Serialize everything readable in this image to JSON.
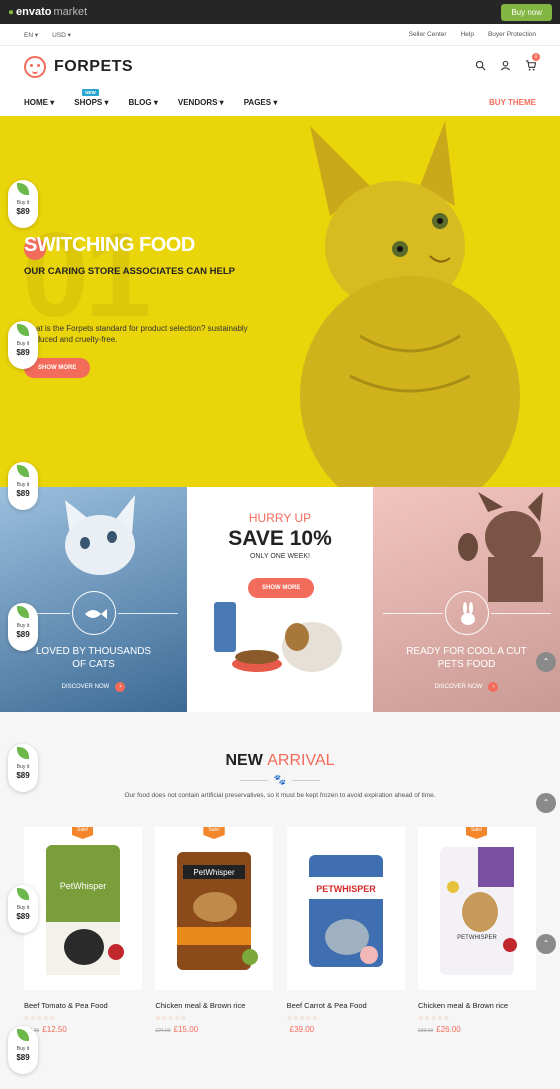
{
  "envato": {
    "logo": "envato",
    "logo_suffix": "market",
    "buy_now": "Buy now"
  },
  "topbar": {
    "lang": "EN",
    "currency": "USD",
    "links": [
      "Seller Center",
      "Help",
      "Buyer Protection"
    ]
  },
  "header": {
    "brand": "FORPETS",
    "cart_count": "0"
  },
  "nav": {
    "items": [
      {
        "label": "HOME",
        "badge": ""
      },
      {
        "label": "SHOPS",
        "badge": "NEW"
      },
      {
        "label": "BLOG",
        "badge": ""
      },
      {
        "label": "VENDORS",
        "badge": ""
      },
      {
        "label": "PAGES",
        "badge": ""
      }
    ],
    "buy_theme": "BUY THEME"
  },
  "hero": {
    "number": "01",
    "title": "SWITCHING FOOD",
    "subtitle": "OUR CARING STORE ASSOCIATES CAN HELP",
    "text": "What is the Forpets standard for product selection? sustainably produced and cruelty-free.",
    "button": "SHOW MORE"
  },
  "panels": {
    "left": {
      "caption": "LOVED BY THOUSANDS OF CATS",
      "link": "DISCOVER NOW"
    },
    "center": {
      "hurry": "HURRY UP",
      "save": "SAVE 10%",
      "only": "ONLY ONE WEEK!",
      "button": "SHOW MORE"
    },
    "right": {
      "caption": "READY FOR COOL A CUT PETS FOOD",
      "link": "DISCOVER NOW"
    }
  },
  "new_arrival": {
    "title_main": "NEW",
    "title_accent": "ARRIVAL",
    "subtitle": "Our food does not contain artificial preservatives, so it must be kept frozen to avoid expiration ahead of time."
  },
  "products": [
    {
      "name": "Beef Tomato & Pea Food",
      "old_price": "£15.00",
      "price": "£12.50",
      "sale": "Sale!",
      "brand": "PetWhisper",
      "color": "#7a9e3a"
    },
    {
      "name": "Chicken meal & Brown rice",
      "old_price": "£24.00",
      "price": "£15.00",
      "sale": "Sale!",
      "brand": "PetWhisper",
      "color": "#d4781f"
    },
    {
      "name": "Beef Carrot & Pea Food",
      "old_price": "",
      "price": "£39.00",
      "sale": "",
      "brand": "PETWHISPER",
      "color": "#3f6fb0"
    },
    {
      "name": "Chicken meal & Brown rice",
      "old_price": "£30.00",
      "price": "£26.00",
      "sale": "Sale!",
      "brand": "PETWHISPER",
      "color": "#7a4fa0"
    }
  ],
  "badge": {
    "label": "Buy it",
    "price": "$89"
  }
}
